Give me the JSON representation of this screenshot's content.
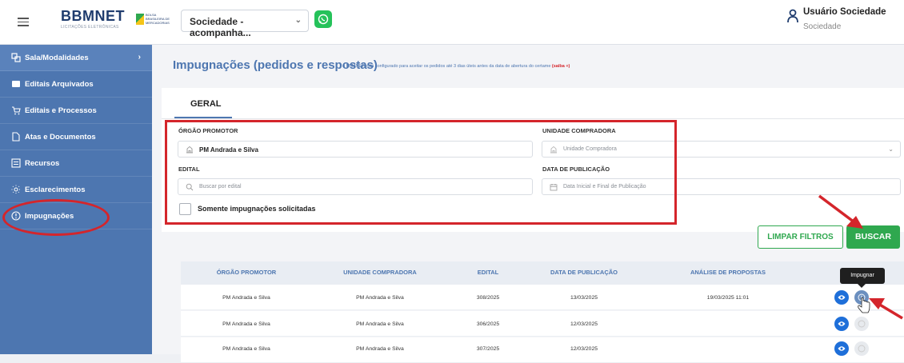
{
  "header": {
    "logo_text": "BBMNET",
    "logo_subtitle": "LICITAÇÕES ELETRÔNICAS",
    "partner_text": "BOLSA BRASILEIRA DE MERCADORIAS",
    "company_select_value": "Sociedade - acompanha...",
    "user_name": "Usuário Sociedade",
    "user_role": "Sociedade"
  },
  "sidebar": {
    "items": [
      {
        "label": "Sala/Modalidades",
        "icon": "rooms-icon",
        "has_arrow": true
      },
      {
        "label": "Editais Arquivados",
        "icon": "archive-icon"
      },
      {
        "label": "Editais e Processos",
        "icon": "cart-icon"
      },
      {
        "label": "Atas e Documentos",
        "icon": "document-icon"
      },
      {
        "label": "Recursos",
        "icon": "list-icon"
      },
      {
        "label": "Esclarecimentos",
        "icon": "sun-icon"
      },
      {
        "label": "Impugnações",
        "icon": "info-circle-icon"
      }
    ]
  },
  "page": {
    "title": "Impugnações (pedidos e respostas)",
    "note": "o BBMNET está configurado para aceitar os pedidos até 3 dias úteis antes da data de abertura do certame",
    "note_link": "(saiba +)",
    "tab": "GERAL"
  },
  "filters": {
    "orgao_label": "ÓRGÃO PROMOTOR",
    "orgao_value": "PM Andrada e Silva",
    "unidade_label": "UNIDADE COMPRADORA",
    "unidade_placeholder": "Unidade Compradora",
    "edital_label": "EDITAL",
    "edital_placeholder": "Buscar por edital",
    "data_label": "DATA DE PUBLICAÇÃO",
    "data_placeholder": "Data Inicial e Final de Publicação",
    "checkbox_label": "Somente impugnações solicitadas",
    "checkbox_checked": false,
    "clear_button": "LIMPAR FILTROS",
    "search_button": "BUSCAR"
  },
  "table": {
    "headers": [
      "ÓRGÃO PROMOTOR",
      "UNIDADE COMPRADORA",
      "EDITAL",
      "DATA DE PUBLICAÇÃO",
      "ANÁLISE DE PROPOSTAS"
    ],
    "rows": [
      {
        "orgao": "PM Andrada e Silva",
        "unidade": "PM Andrada e Silva",
        "edital": "308/2025",
        "data": "13/03/2025",
        "analise": "19/03/2025 11:01"
      },
      {
        "orgao": "PM Andrada e Silva",
        "unidade": "PM Andrada e Silva",
        "edital": "306/2025",
        "data": "12/03/2025",
        "analise": ""
      },
      {
        "orgao": "PM Andrada e Silva",
        "unidade": "PM Andrada e Silva",
        "edital": "307/2025",
        "data": "12/03/2025",
        "analise": ""
      }
    ],
    "tooltip": "Impugnar"
  },
  "colors": {
    "primary": "#4d76b0",
    "green": "#2fa84f",
    "annotation_red": "#d4252b",
    "action_blue": "#1e6fd9"
  }
}
